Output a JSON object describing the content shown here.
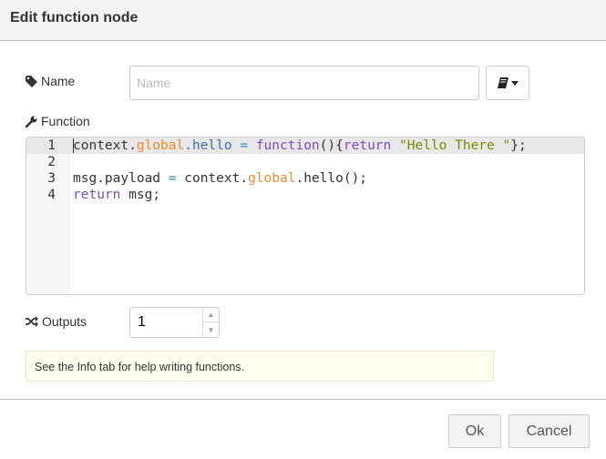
{
  "dialog": {
    "title": "Edit function node"
  },
  "name": {
    "label": "Name",
    "placeholder": "Name",
    "value": "",
    "icon": "tag-icon"
  },
  "function": {
    "label": "Function",
    "icon": "wrench-icon",
    "lines": [
      {
        "n": "1",
        "tokens": [
          [
            "context",
            ""
          ],
          [
            ".",
            ""
          ],
          [
            "global",
            "gl"
          ],
          [
            ".hello",
            "pr"
          ],
          [
            " ",
            ""
          ],
          [
            "=",
            "op"
          ],
          [
            " ",
            ""
          ],
          [
            "function",
            "kw"
          ],
          [
            "(){",
            ""
          ],
          [
            "return",
            "kw"
          ],
          [
            " ",
            ""
          ],
          [
            "\"Hello There \"",
            "st"
          ],
          [
            "};",
            ""
          ]
        ]
      },
      {
        "n": "2",
        "tokens": []
      },
      {
        "n": "3",
        "tokens": [
          [
            "msg.payload ",
            ""
          ],
          [
            "=",
            "op"
          ],
          [
            " context.",
            ""
          ],
          [
            "global",
            "gl"
          ],
          [
            ".hello();",
            ""
          ]
        ]
      },
      {
        "n": "4",
        "tokens": [
          [
            "return",
            "kw"
          ],
          [
            " msg;",
            ""
          ]
        ]
      }
    ]
  },
  "outputs": {
    "label": "Outputs",
    "value": "1",
    "icon": "shuffle-icon"
  },
  "tip": "See the Info tab for help writing functions.",
  "footer": {
    "ok": "Ok",
    "cancel": "Cancel"
  }
}
